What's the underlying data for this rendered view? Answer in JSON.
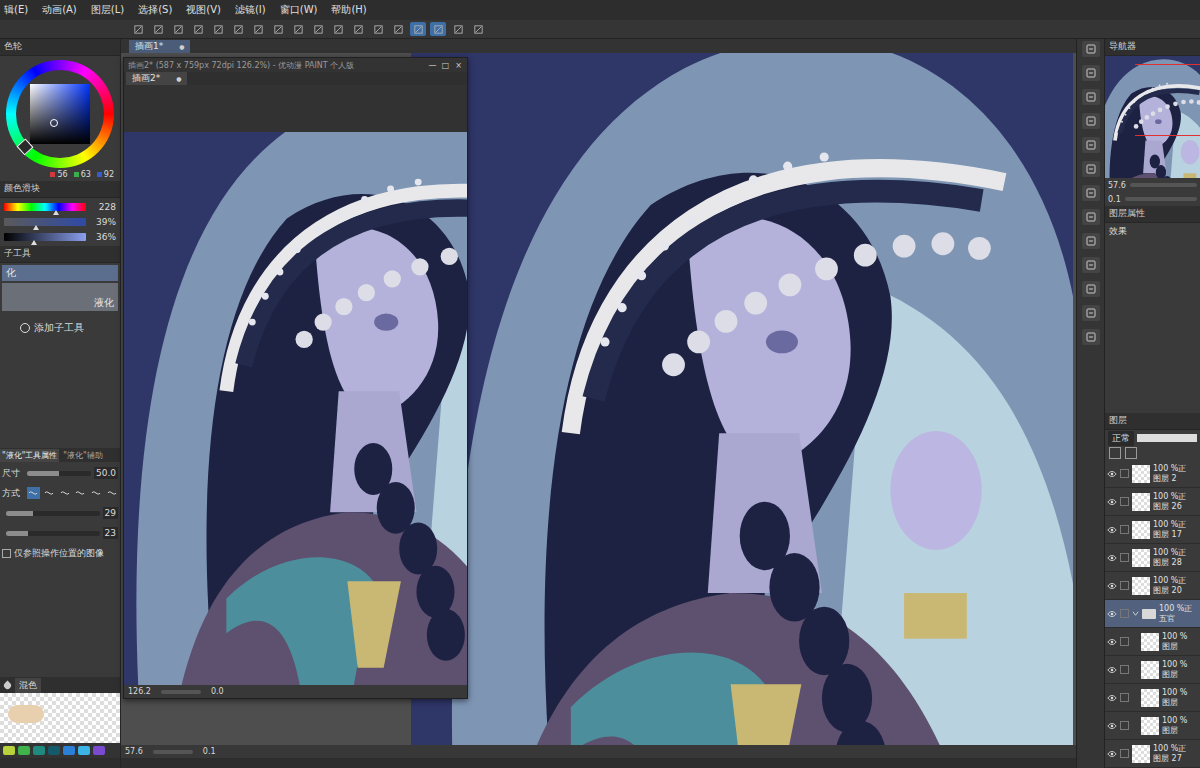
{
  "menu": [
    "辑(E)",
    "动画(A)",
    "图层(L)",
    "选择(S)",
    "视图(V)",
    "滤镜(I)",
    "窗口(W)",
    "帮助(H)"
  ],
  "toolbar": [
    {
      "on": false
    },
    {
      "on": false
    },
    {
      "on": false
    },
    {
      "on": false
    },
    {
      "on": false
    },
    {
      "on": false
    },
    {
      "on": false
    },
    {
      "on": false
    },
    {
      "on": false
    },
    {
      "on": false
    },
    {
      "on": false
    },
    {
      "on": false
    },
    {
      "on": false
    },
    {
      "on": false
    },
    {
      "on": true
    },
    {
      "on": true
    },
    {
      "on": false
    },
    {
      "on": false
    }
  ],
  "document_tab": {
    "label": "插画1*",
    "close": "●"
  },
  "color_wheel": {
    "title": "色轮",
    "values": [
      {
        "label": "56",
        "color": "#d03a3a"
      },
      {
        "label": "63",
        "color": "#3ab04a"
      },
      {
        "label": "92",
        "color": "#3a5ad0"
      }
    ]
  },
  "color_sliders": {
    "title": "颜色滑块",
    "sliders": [
      {
        "reading": "228",
        "level": 0.63
      },
      {
        "reading": "39%",
        "level": 0.39
      },
      {
        "reading": "36%",
        "level": 0.36
      }
    ]
  },
  "sub_tool": {
    "title": "子工具",
    "items": [
      {
        "label": "化",
        "selected": true
      },
      {
        "label": "液化",
        "selected": false
      }
    ],
    "add": "添加子工具"
  },
  "tool_property": {
    "tabs": [
      {
        "label": "\"液化\"工具属性",
        "selected": true
      },
      {
        "label": "\"液化\"辅助",
        "selected": false
      }
    ],
    "rows": [
      {
        "kind": "value",
        "label": "尺寸",
        "reading": "50.0",
        "level": 0.5
      },
      {
        "kind": "modes",
        "label": "方式",
        "modes": [
          {
            "selected": true
          },
          {
            "selected": false
          },
          {
            "selected": false
          },
          {
            "selected": false
          },
          {
            "selected": false
          },
          {
            "selected": false
          }
        ]
      },
      {
        "kind": "slider",
        "reading": "29",
        "level": 0.29
      },
      {
        "kind": "slider",
        "reading": "23",
        "level": 0.23
      },
      {
        "kind": "check",
        "label": "仅参照操作位置的图像",
        "checked": false
      }
    ]
  },
  "color_set": {
    "tab": "混色",
    "swatches": [
      {
        "color": "#b7d23a"
      },
      {
        "color": "#3fb24a"
      },
      {
        "color": "#1f8a7e"
      },
      {
        "color": "#155a6a"
      },
      {
        "color": "#2c7fd6"
      },
      {
        "color": "#3cb4e6"
      },
      {
        "color": "#7a4ad0"
      }
    ]
  },
  "float_window": {
    "title": "插画2* (587 x 759px 72dpi 126.2%) - 优动漫 PAINT 个人版",
    "controls": [
      "—",
      "□",
      "×"
    ],
    "tab": {
      "label": "插画2*",
      "close": "●"
    },
    "status": {
      "zoom": "126.2",
      "angle": "0.0"
    }
  },
  "canvas_status": {
    "zoom": "57.6",
    "angle": "0.1"
  },
  "navigator": {
    "title": "导航器",
    "zoom": "57.6",
    "angle": "0.1"
  },
  "layer_property": {
    "title": "图层属性",
    "effect": "效果"
  },
  "layer_panel": {
    "title": "图层",
    "blend": "正常",
    "layers": [
      {
        "opacity": "100 %正",
        "name": "图层 2",
        "visible": true,
        "folder": false,
        "expanded": false,
        "in_folder": false,
        "selected": false
      },
      {
        "opacity": "100 %正",
        "name": "图层 26",
        "visible": true,
        "folder": false,
        "expanded": false,
        "in_folder": false,
        "selected": false
      },
      {
        "opacity": "100 %正",
        "name": "图层 17",
        "visible": true,
        "folder": false,
        "expanded": false,
        "in_folder": false,
        "selected": false
      },
      {
        "opacity": "100 %正",
        "name": "图层 28",
        "visible": true,
        "folder": false,
        "expanded": false,
        "in_folder": false,
        "selected": false
      },
      {
        "opacity": "100 %正",
        "name": "图层 20",
        "visible": true,
        "folder": false,
        "expanded": false,
        "in_folder": false,
        "selected": false
      },
      {
        "opacity": "100 %正",
        "name": "五官",
        "visible": true,
        "folder": true,
        "expanded": true,
        "in_folder": false,
        "selected": true
      },
      {
        "opacity": "100 %",
        "name": "图层",
        "visible": true,
        "folder": false,
        "expanded": false,
        "in_folder": true,
        "selected": false
      },
      {
        "opacity": "100 %",
        "name": "图层",
        "visible": true,
        "folder": false,
        "expanded": false,
        "in_folder": true,
        "selected": false
      },
      {
        "opacity": "100 %",
        "name": "图层",
        "visible": true,
        "folder": false,
        "expanded": false,
        "in_folder": true,
        "selected": false
      },
      {
        "opacity": "100 %",
        "name": "图层",
        "visible": true,
        "folder": false,
        "expanded": false,
        "in_folder": true,
        "selected": false
      },
      {
        "opacity": "100 %正",
        "name": "图层 27",
        "visible": true,
        "folder": false,
        "expanded": false,
        "in_folder": false,
        "selected": false
      }
    ]
  }
}
